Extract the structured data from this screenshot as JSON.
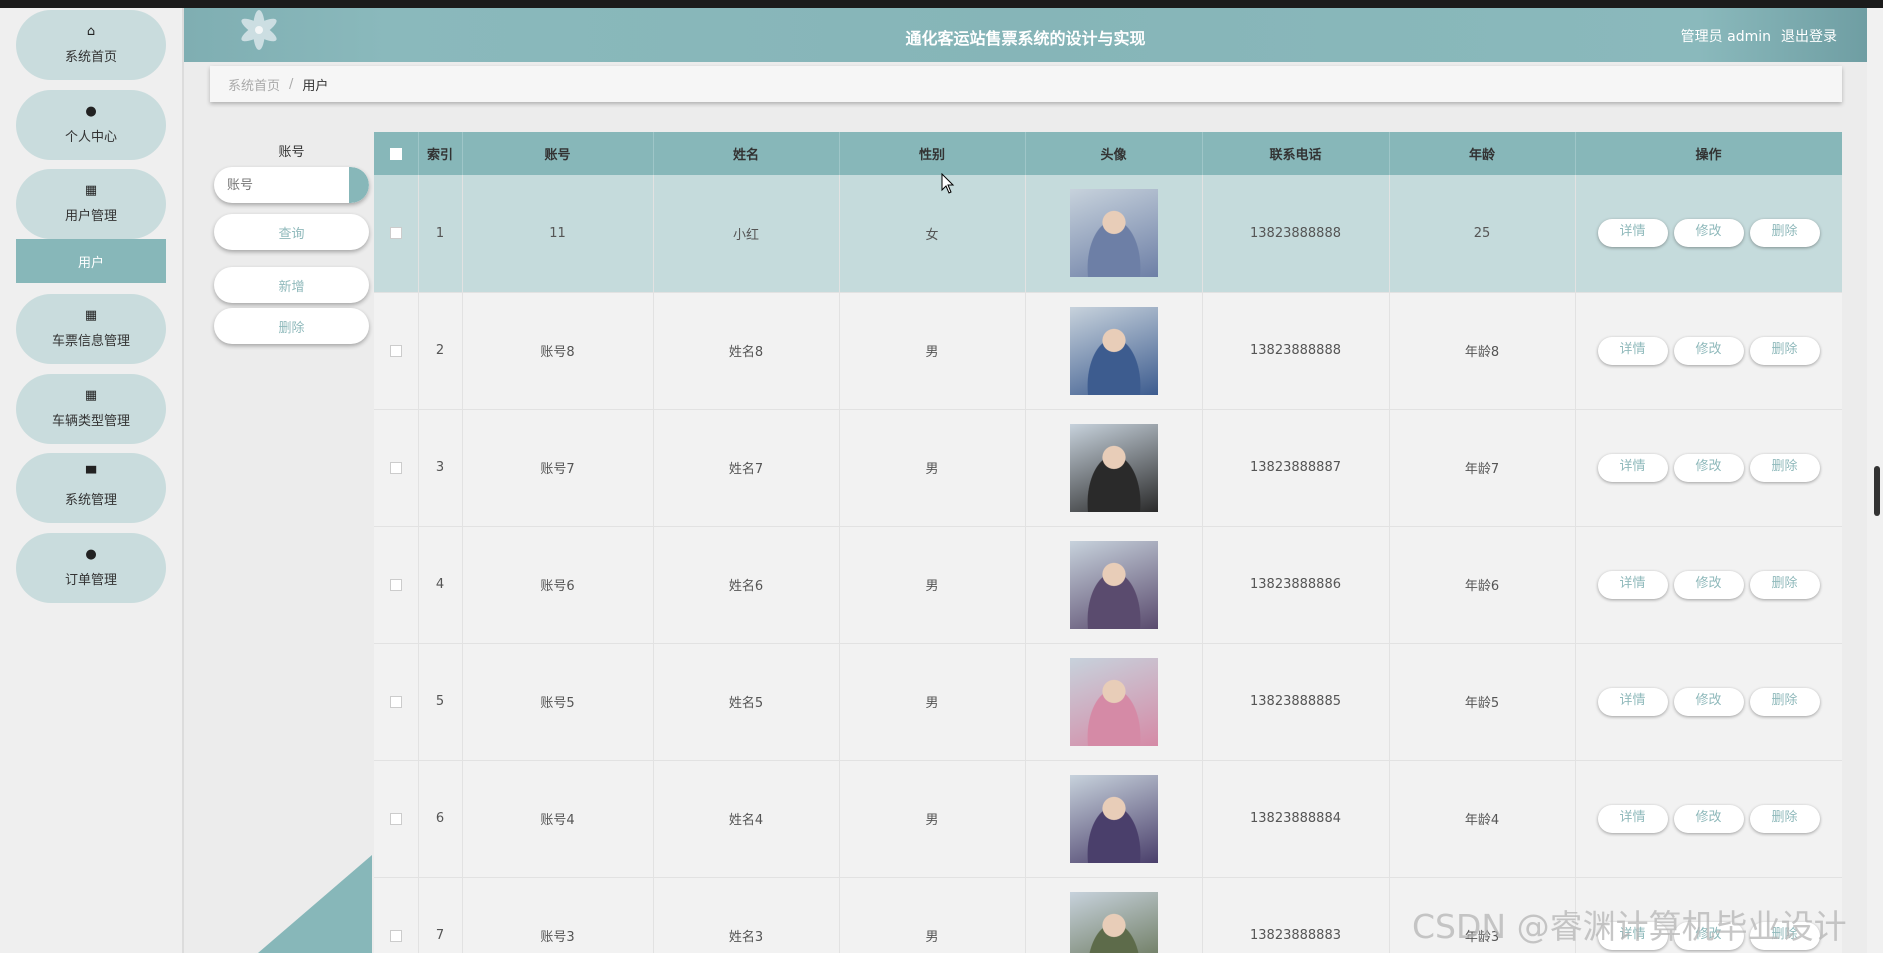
{
  "header": {
    "title": "通化客运站售票系统的设计与实现",
    "role_label": "管理员 admin",
    "logout_label": "退出登录"
  },
  "sidebar": {
    "items": [
      {
        "label": "系统首页",
        "icon": "home-icon",
        "glyph": "⌂"
      },
      {
        "label": "个人中心",
        "icon": "user-icon",
        "glyph": "●"
      },
      {
        "label": "用户管理",
        "icon": "grid-icon",
        "glyph": "▦"
      },
      {
        "label": "车票信息管理",
        "icon": "grid-icon",
        "glyph": "▦"
      },
      {
        "label": "车辆类型管理",
        "icon": "grid-icon",
        "glyph": "▦"
      },
      {
        "label": "系统管理",
        "icon": "monitor-icon",
        "glyph": "▀"
      },
      {
        "label": "订单管理",
        "icon": "user-icon",
        "glyph": "●"
      }
    ],
    "active_sub": "用户"
  },
  "breadcrumb": {
    "home": "系统首页",
    "separator": "/",
    "current": "用户"
  },
  "search": {
    "label": "账号",
    "placeholder": "账号",
    "query_button": "查询",
    "add_button": "新增",
    "delete_button": "删除"
  },
  "table": {
    "columns": [
      "索引",
      "账号",
      "姓名",
      "性别",
      "头像",
      "联系电话",
      "年龄",
      "操作"
    ],
    "actions": [
      "详情",
      "修改",
      "删除"
    ],
    "rows": [
      {
        "index": "1",
        "account": "11",
        "name": "小红",
        "gender": "女",
        "phone": "13823888888",
        "age": "25",
        "avatar_color": "#6d7fa6"
      },
      {
        "index": "2",
        "account": "账号8",
        "name": "姓名8",
        "gender": "男",
        "phone": "13823888888",
        "age": "年龄8",
        "avatar_color": "#3d5c8f"
      },
      {
        "index": "3",
        "account": "账号7",
        "name": "姓名7",
        "gender": "男",
        "phone": "13823888887",
        "age": "年龄7",
        "avatar_color": "#2a2a2a"
      },
      {
        "index": "4",
        "account": "账号6",
        "name": "姓名6",
        "gender": "男",
        "phone": "13823888886",
        "age": "年龄6",
        "avatar_color": "#5a4b6e"
      },
      {
        "index": "5",
        "account": "账号5",
        "name": "姓名5",
        "gender": "男",
        "phone": "13823888885",
        "age": "年龄5",
        "avatar_color": "#d58aa6"
      },
      {
        "index": "6",
        "account": "账号4",
        "name": "姓名4",
        "gender": "男",
        "phone": "13823888884",
        "age": "年龄4",
        "avatar_color": "#4a3f6b"
      },
      {
        "index": "7",
        "account": "账号3",
        "name": "姓名3",
        "gender": "男",
        "phone": "13823888883",
        "age": "年龄3",
        "avatar_color": "#5d6b4a"
      }
    ]
  },
  "watermark": "CSDN @睿渊计算机毕业设计",
  "colors": {
    "accent": "#87b7b9",
    "menu_bg": "#c9dcdd",
    "highlight_row": "#c5dbdc"
  }
}
